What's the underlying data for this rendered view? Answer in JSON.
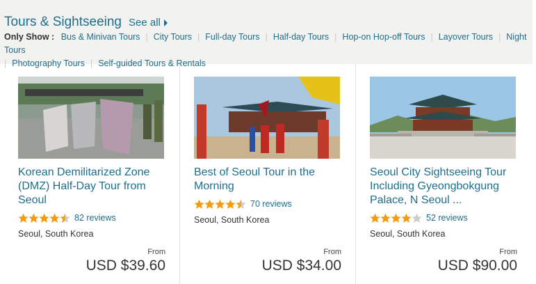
{
  "section": {
    "title": "Tours & Sightseeing",
    "see_all": "See all"
  },
  "filters": {
    "label": "Only Show :",
    "items": [
      "Bus & Minivan Tours",
      "City Tours",
      "Full-day Tours",
      "Half-day Tours",
      "Hop-on Hop-off Tours",
      "Layover Tours",
      "Night Tours",
      "Photography Tours",
      "Self-guided Tours & Rentals"
    ]
  },
  "cards": [
    {
      "title": "Korean Demilitarized Zone (DMZ) Half-Day Tour from Seoul",
      "rating": 4.5,
      "reviews": "82 reviews",
      "location": "Seoul, South Korea",
      "from": "From",
      "price": "USD $39.60",
      "image": "dmz-sign-photo"
    },
    {
      "title": "Best of Seoul Tour in the Morning",
      "rating": 4.5,
      "reviews": "70 reviews",
      "location": "Seoul, South Korea",
      "from": "From",
      "price": "USD $34.00",
      "image": "palace-guard-ceremony-photo"
    },
    {
      "title": "Seoul City Sightseeing Tour Including Gyeongbokgung Palace, N Seoul ...",
      "rating": 4,
      "reviews": "52 reviews",
      "location": "Seoul, South Korea",
      "from": "From",
      "price": "USD $90.00",
      "image": "gyeongbokgung-palace-photo"
    }
  ],
  "colors": {
    "link": "#1f6e8c",
    "star": "#f39c12",
    "star_empty": "#cccccc",
    "header_bg": "#f2f2f0"
  }
}
